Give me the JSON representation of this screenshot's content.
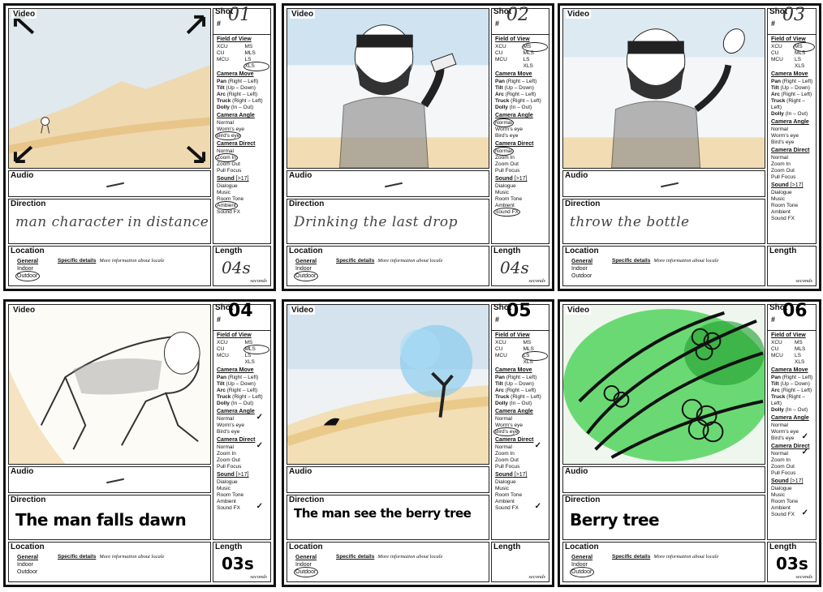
{
  "labels": {
    "video": "Video",
    "shot": "Shot",
    "hash": "#",
    "field_of_view": "Field of View",
    "camera_move": "Camera Move",
    "camera_angle": "Camera Angle",
    "camera_direct": "Camera Direct",
    "sound": "Sound",
    "sound_note": "[>17]",
    "audio": "Audio",
    "direction": "Direction",
    "location": "Location",
    "length": "Length",
    "seconds": "seconds",
    "general": "General",
    "specific_details": "Specific details",
    "more_info": "More information about locale"
  },
  "fov": [
    "XCU",
    "MS",
    "CU",
    "MLS",
    "MCU",
    "LS",
    "",
    "XLS"
  ],
  "camera_move": [
    {
      "b": "Pan",
      "t": " (Right – Left)"
    },
    {
      "b": "Tilt",
      "t": " (Up – Down)"
    },
    {
      "b": "Arc",
      "t": " (Right – Left)"
    },
    {
      "b": "Truck",
      "t": " (Right – Left)"
    },
    {
      "b": "Dolly",
      "t": " (In – Out)"
    }
  ],
  "camera_angle": [
    "Normal",
    "Worm's eye",
    "Bird's eye"
  ],
  "camera_direct": [
    "Normal",
    "Zoom In",
    "Zoom Out",
    "Pull Focus"
  ],
  "sound": [
    "Dialogue",
    "Music",
    "Room Tone",
    "Ambient",
    "Sound FX"
  ],
  "location_options": [
    "Indoor",
    "Outdoor"
  ],
  "panels": [
    {
      "shot": "01",
      "direction": "man character in distance",
      "length": "04s",
      "audio": "—",
      "ink": false
    },
    {
      "shot": "02",
      "direction": "Drinking the last drop",
      "length": "04s",
      "audio": "—",
      "ink": false
    },
    {
      "shot": "03",
      "direction": "throw the bottle",
      "length": "",
      "audio": "—",
      "ink": false
    },
    {
      "shot": "04",
      "direction": "The man falls dawn",
      "length": "03s",
      "audio": "—",
      "ink": true
    },
    {
      "shot": "05",
      "direction": "The man see the berry tree",
      "length": "",
      "audio": "",
      "ink": true
    },
    {
      "shot": "06",
      "direction": "Berry tree",
      "length": "03s",
      "audio": "",
      "ink": true
    }
  ]
}
